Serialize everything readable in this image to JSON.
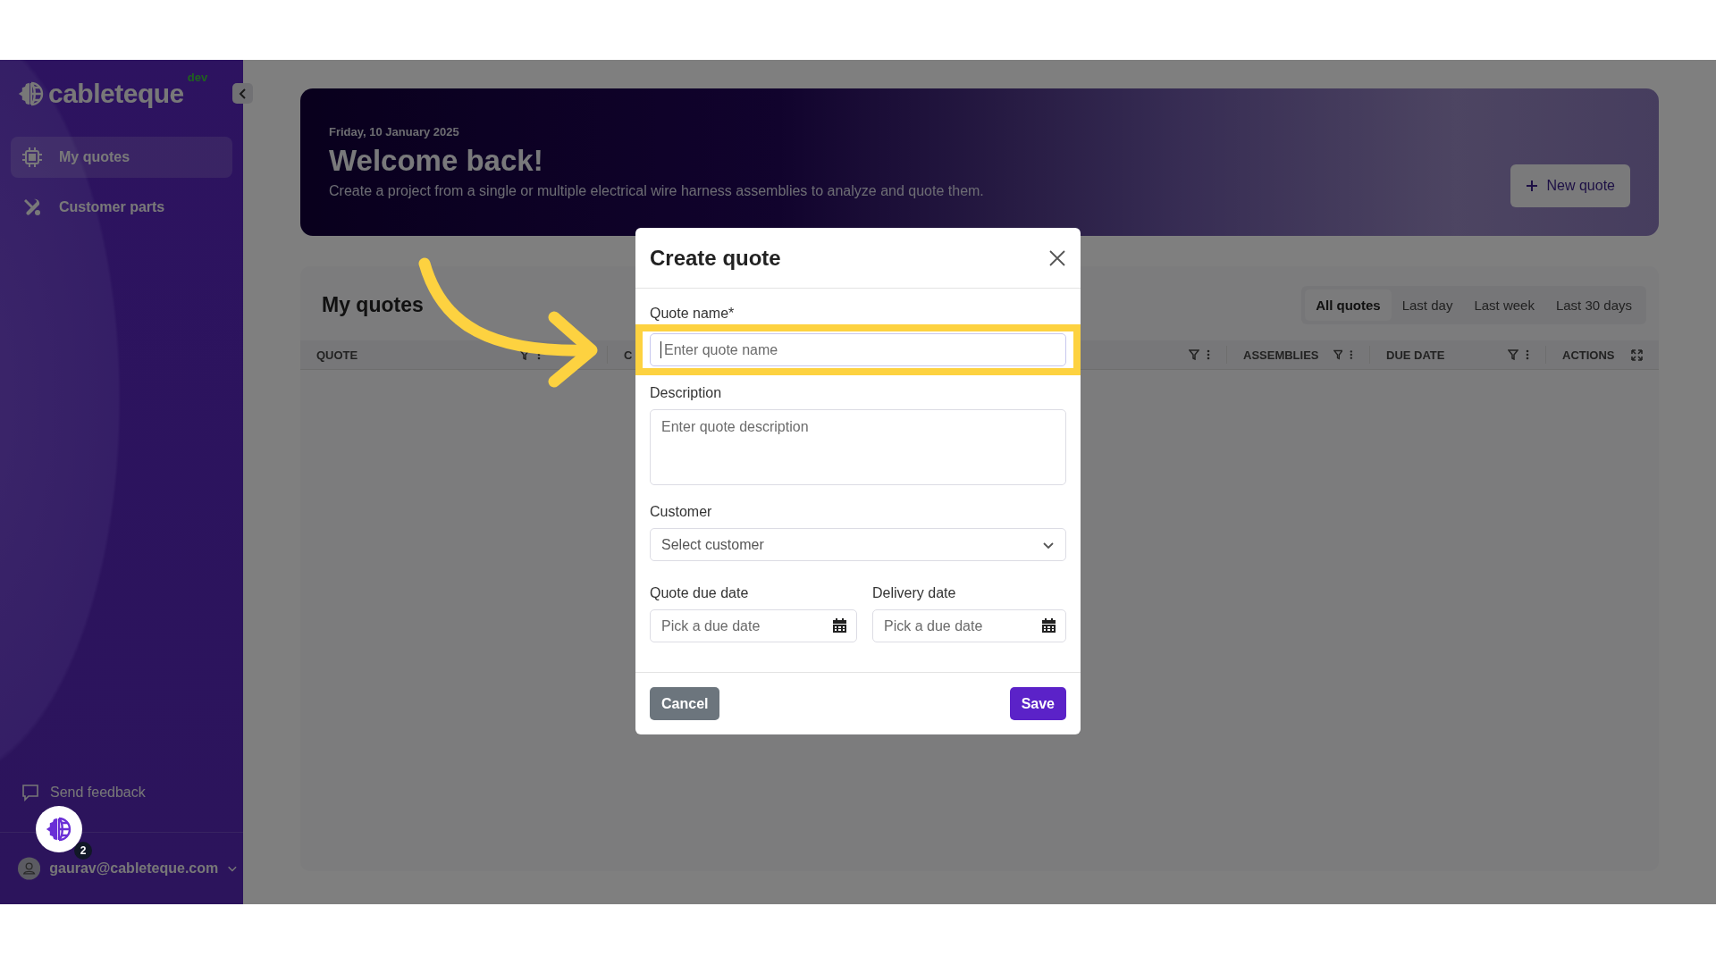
{
  "sidebar": {
    "logo": "cableteque",
    "env_badge": "dev",
    "items": [
      {
        "label": "My quotes",
        "selected": true
      },
      {
        "label": "Customer parts",
        "selected": false
      }
    ],
    "feedback": "Send feedback",
    "user_email": "gaurav@cableteque.com",
    "user_menu_expanded": false
  },
  "banner": {
    "date": "Friday, 10 January 2025",
    "title": "Welcome back!",
    "subtitle": "Create a project from a single or multiple electrical wire harness assemblies to analyze and quote them.",
    "button": "New quote"
  },
  "quotes": {
    "title": "My quotes",
    "filters": [
      {
        "label": "All quotes",
        "selected": true
      },
      {
        "label": "Last day",
        "selected": false
      },
      {
        "label": "Last week",
        "selected": false
      },
      {
        "label": "Last 30 days",
        "selected": false
      }
    ],
    "columns": [
      {
        "label": "QUOTE",
        "kind": "data"
      },
      {
        "label": "C",
        "kind": "data"
      },
      {
        "label": "ASSEMBLIES",
        "kind": "data"
      },
      {
        "label": "DUE DATE",
        "kind": "data"
      },
      {
        "label": "ACTIONS",
        "kind": "actions"
      }
    ]
  },
  "dialog": {
    "title": "Create quote",
    "fields": [
      {
        "kind": "text",
        "label": "Quote name*",
        "placeholder": "Enter quote name",
        "focused": true
      },
      {
        "kind": "textarea",
        "label": "Description",
        "placeholder": "Enter quote description",
        "focused": false
      },
      {
        "kind": "select",
        "label": "Customer",
        "placeholder": "Select customer",
        "focused": false
      },
      {
        "kind": "date",
        "label": "Quote due date",
        "placeholder": "Pick a due date",
        "focused": false
      },
      {
        "kind": "date",
        "label": "Delivery date",
        "placeholder": "Pick a due date",
        "focused": false
      }
    ],
    "buttons": [
      {
        "label": "Cancel",
        "kind": "secondary"
      },
      {
        "label": "Save",
        "kind": "primary"
      }
    ]
  },
  "help_widget": {
    "badge": "2"
  }
}
